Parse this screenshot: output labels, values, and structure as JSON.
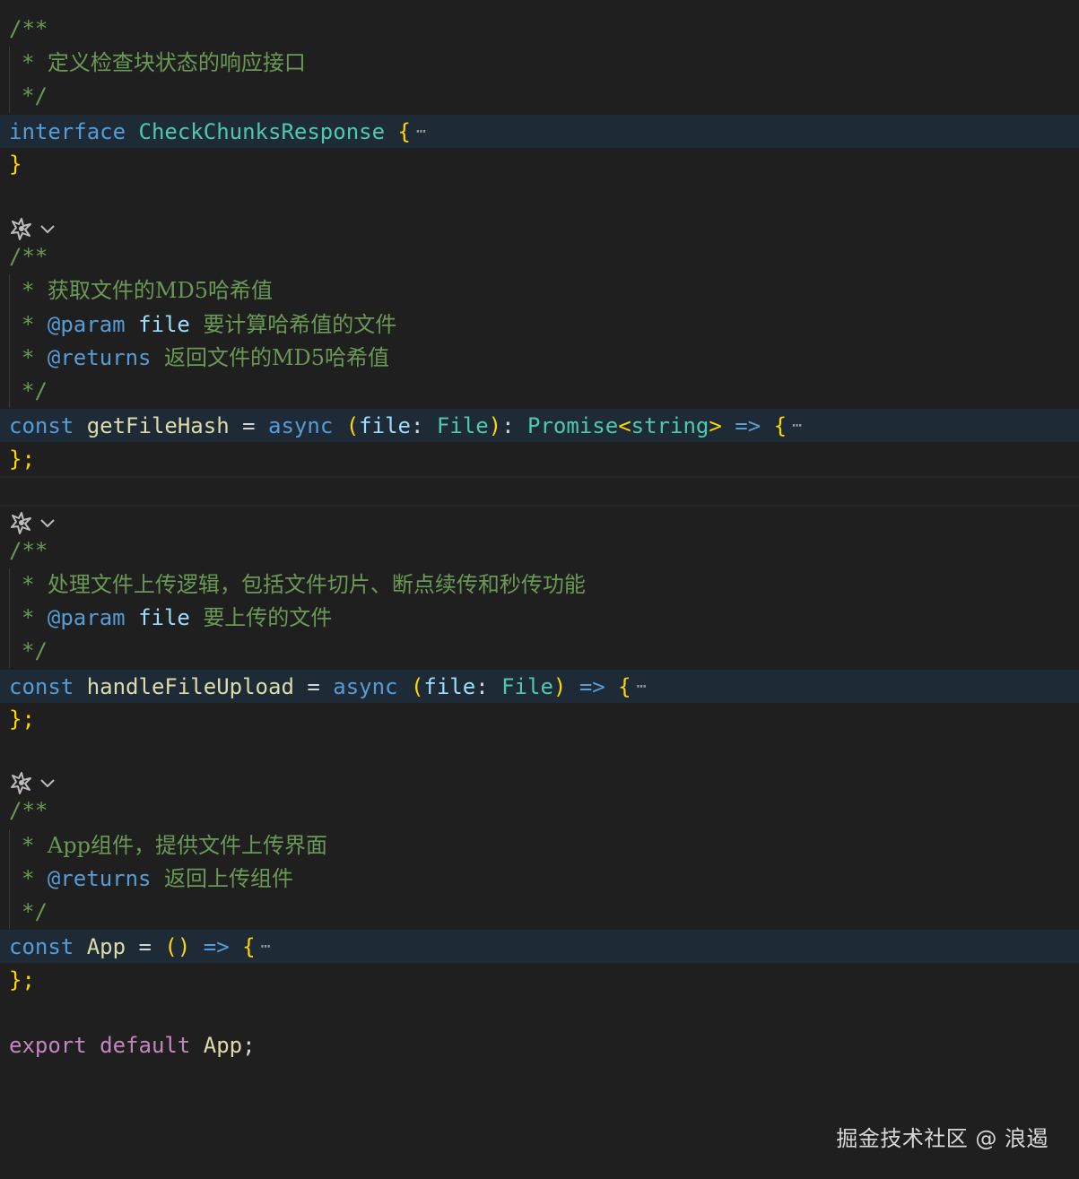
{
  "editor": {
    "blocks": [
      {
        "id": "interface",
        "doc_open": "/**",
        "doc_lines": [
          {
            "star": "*",
            "text": "定义检查块状态的响应接口"
          }
        ],
        "doc_close": "*/",
        "decl": {
          "kw": "interface",
          "name": "CheckChunksResponse",
          "brace": "{",
          "fold": "⋯"
        },
        "close": "}"
      },
      {
        "id": "get-file-hash",
        "doc_open": "/**",
        "doc_lines": [
          {
            "star": "*",
            "text": "获取文件的MD5哈希值"
          },
          {
            "star": "*",
            "tag": "@param",
            "param": "file",
            "text": "要计算哈希值的文件"
          },
          {
            "star": "*",
            "tag": "@returns",
            "text": "返回文件的MD5哈希值"
          }
        ],
        "doc_close": "*/",
        "decl": {
          "kw": "const",
          "name": "getFileHash",
          "eq": "=",
          "async": "async",
          "paren_open": "(",
          "param": "file",
          "colon": ":",
          "param_type": "File",
          "paren_close": ")",
          "ret_colon": ":",
          "ret_type": "Promise",
          "generic_open": "<",
          "generic_type": "string",
          "generic_close": ">",
          "arrow": "=>",
          "brace": "{",
          "fold": "⋯"
        },
        "close": "};"
      },
      {
        "id": "handle-file-upload",
        "doc_open": "/**",
        "doc_lines": [
          {
            "star": "*",
            "text": "处理文件上传逻辑，包括文件切片、断点续传和秒传功能"
          },
          {
            "star": "*",
            "tag": "@param",
            "param": "file",
            "text": "要上传的文件"
          }
        ],
        "doc_close": "*/",
        "decl": {
          "kw": "const",
          "name": "handleFileUpload",
          "eq": "=",
          "async": "async",
          "paren_open": "(",
          "param": "file",
          "colon": ":",
          "param_type": "File",
          "paren_close": ")",
          "arrow": "=>",
          "brace": "{",
          "fold": "⋯"
        },
        "close": "};"
      },
      {
        "id": "app",
        "doc_open": "/**",
        "doc_lines": [
          {
            "star": "*",
            "text": "App组件，提供文件上传界面"
          },
          {
            "star": "*",
            "tag": "@returns",
            "text": "返回上传组件"
          }
        ],
        "doc_close": "*/",
        "decl": {
          "kw": "const",
          "name": "App",
          "eq": "=",
          "parens": "()",
          "arrow": "=>",
          "brace": "{",
          "fold": "⋯"
        },
        "close": "};"
      }
    ],
    "export_line": {
      "export": "export",
      "default": "default",
      "name": "App",
      "semi": ";"
    }
  },
  "watermark": "掘金技术社区 @ 浪遏",
  "icons": {
    "codelens": "ai-sparkle-icon",
    "codelens_chevron": "chevron-down-icon"
  },
  "colors": {
    "background": "#1f1f1f",
    "folded_line": "#1e2a36",
    "comment": "#6a9955",
    "keyword": "#569cd6",
    "control": "#c586c0",
    "type": "#4ec9b0",
    "function": "#dcdcaa",
    "variable": "#9cdcfe",
    "brace": "#ffd700",
    "paren": "#da70d6"
  }
}
